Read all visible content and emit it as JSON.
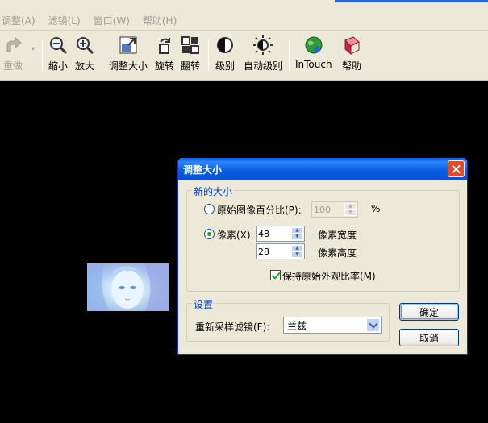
{
  "menu": [
    "调整(A)",
    "滤镜(L)",
    "窗口(W)",
    "帮助(H)"
  ],
  "toolbar": {
    "redo": "重做",
    "zoom_out": "缩小",
    "zoom_in": "放大",
    "resize": "调整大小",
    "rotate": "旋转",
    "flip": "翻转",
    "levels": "级别",
    "auto_levels": "自动级别",
    "intouch": "InTouch",
    "help": "帮助"
  },
  "colors": {
    "dialog_title_bg": "#0a5ee2",
    "group_title": "#0046d5",
    "close_button": "#e34a28",
    "canvas_bg": "#000000",
    "check_mark": "#21a121"
  },
  "dialog": {
    "title": "调整大小",
    "new_size": {
      "group_title": "新的大小",
      "percent_label": "原始图像百分比(P):",
      "percent_value": "100",
      "percent_unit": "%",
      "pixels_label": "像素(X):",
      "width_value": "48",
      "width_label": "像素宽度",
      "height_value": "28",
      "height_label": "像素高度",
      "keep_ratio_label": "保持原始外观比率(M)"
    },
    "settings": {
      "group_title": "设置",
      "filter_label": "重新采样滤镜(F):",
      "filter_value": "兰兹"
    },
    "ok": "确定",
    "cancel": "取消"
  }
}
